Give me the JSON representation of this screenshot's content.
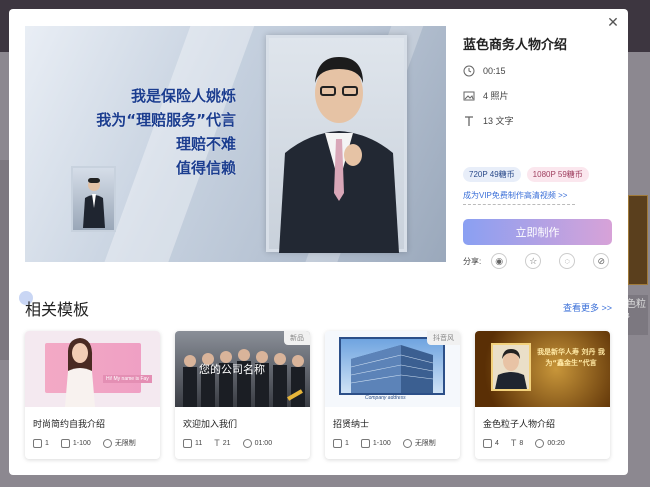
{
  "background": {
    "right_peek_text": "色粒",
    "right_peek_count": "4"
  },
  "modal": {
    "close_icon": "close-icon",
    "preview": {
      "slogan_lines": [
        "我是保险人姚烁",
        "我为“理赔服务”代言",
        "理赔不难",
        "值得信赖"
      ]
    },
    "info": {
      "title": "蓝色商务人物介绍",
      "duration": "00:15",
      "photos": "4 照片",
      "text_count": "13 文字",
      "price_720": "720P 49糖币",
      "price_1080": "1080P 59糖币",
      "vip_link": "成为VIP免费制作高清视频 >>",
      "make_button": "立即制作",
      "share_label": "分享:",
      "share_icons": [
        "qq-icon",
        "qzone-icon",
        "weibo-icon",
        "link-icon"
      ]
    },
    "related": {
      "title": "相关模板",
      "see_more": "查看更多 >>",
      "cards": [
        {
          "name": "时尚简约自我介绍",
          "tag": "",
          "thumb_text": "Hi! My name is Fay",
          "stat_a": "1",
          "stat_b": "1-100",
          "stat_c": "无限制"
        },
        {
          "name": "欢迎加入我们",
          "tag": "新品",
          "thumb_text": "您的公司名称",
          "stat_a": "11",
          "stat_b": "21",
          "stat_c": "01:00"
        },
        {
          "name": "招贤纳士",
          "tag": "抖音风",
          "thumb_text": "Company address",
          "stat_a": "1",
          "stat_b": "1-100",
          "stat_c": "无限制"
        },
        {
          "name": "金色粒子人物介绍",
          "tag": "",
          "thumb_text": "我是新华人寿 刘丹 我为“鑫金生”代言",
          "stat_a": "4",
          "stat_b": "8",
          "stat_c": "00:20"
        }
      ]
    }
  },
  "colors": {
    "accent_blue": "#3a6fd8",
    "button_gradient_start": "#8aa0f2",
    "button_gradient_end": "#d7a2d8"
  }
}
